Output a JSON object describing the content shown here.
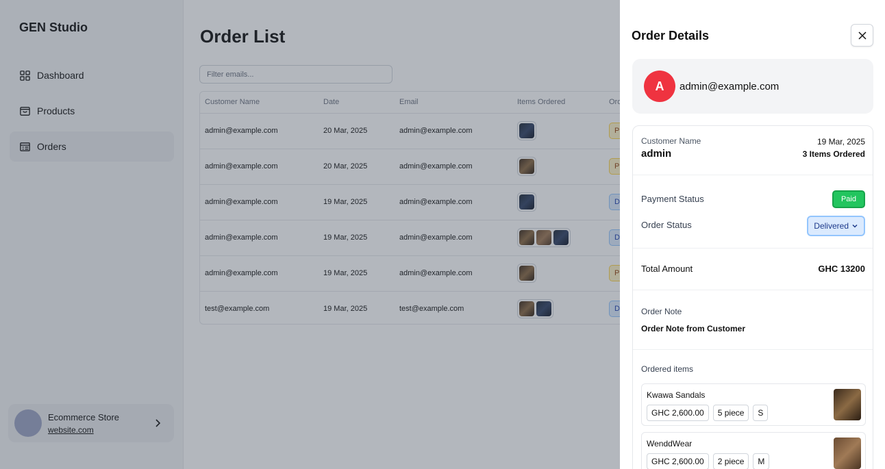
{
  "sidebar": {
    "brand": "GEN Studio",
    "nav": [
      {
        "label": "Dashboard",
        "icon": "dashboard-icon"
      },
      {
        "label": "Products",
        "icon": "products-icon"
      },
      {
        "label": "Orders",
        "icon": "orders-icon",
        "active": true
      }
    ],
    "profile": {
      "name": "Ecommerce Store",
      "site": "website.com"
    }
  },
  "main": {
    "title": "Order List",
    "filter_placeholder": "Filter emails...",
    "columns": [
      "Customer Name",
      "Date",
      "Email",
      "Items Ordered",
      "Ord"
    ],
    "rows": [
      {
        "name": "admin@example.com",
        "date": "20 Mar, 2025",
        "email": "admin@example.com",
        "status": "P"
      },
      {
        "name": "admin@example.com",
        "date": "20 Mar, 2025",
        "email": "admin@example.com",
        "status": "P"
      },
      {
        "name": "admin@example.com",
        "date": "19 Mar, 2025",
        "email": "admin@example.com",
        "status": "D"
      },
      {
        "name": "admin@example.com",
        "date": "19 Mar, 2025",
        "email": "admin@example.com",
        "status": "D"
      },
      {
        "name": "admin@example.com",
        "date": "19 Mar, 2025",
        "email": "admin@example.com",
        "status": "P"
      },
      {
        "name": "test@example.com",
        "date": "19 Mar, 2025",
        "email": "test@example.com",
        "status": "D"
      }
    ]
  },
  "drawer": {
    "title": "Order Details",
    "customer": {
      "initial": "A",
      "email": "admin@example.com"
    },
    "customer_name_label": "Customer Name",
    "customer_name": "admin",
    "date": "19 Mar, 2025",
    "items_ordered": "3  Items Ordered",
    "payment_status_label": "Payment Status",
    "payment_status": "Paid",
    "order_status_label": "Order Status",
    "order_status": "Delivered",
    "total_label": "Total Amount",
    "total_value": "GHC 13200",
    "note_label": "Order Note",
    "note_value": "Order Note from Customer",
    "ordered_items_label": "Ordered items",
    "items": [
      {
        "name": "Kwawa Sandals",
        "price": "GHC 2,600.00",
        "qty": "5 piece",
        "size": "S"
      },
      {
        "name": "WenddWear",
        "price": "GHC 2,600.00",
        "qty": "2 piece",
        "size": "M"
      }
    ]
  },
  "colors": {
    "accent_red": "#ef3340",
    "paid_green": "#22c55e",
    "delivered_blue": "#dbeafe"
  }
}
